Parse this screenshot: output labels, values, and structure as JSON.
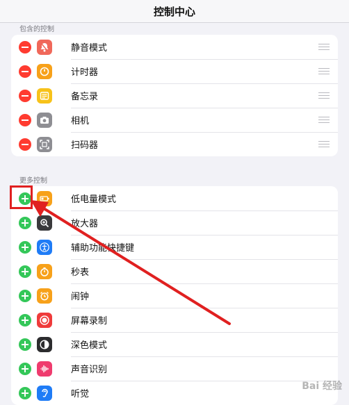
{
  "header": {
    "title": "控制中心"
  },
  "included": {
    "section_label": "包含的控制",
    "items": [
      {
        "label": "静音模式",
        "icon": "bell-slash-icon",
        "color": "#f0685a"
      },
      {
        "label": "计时器",
        "icon": "timer-icon",
        "color": "#f7a11a"
      },
      {
        "label": "备忘录",
        "icon": "notes-icon",
        "color": "#f7c21a"
      },
      {
        "label": "相机",
        "icon": "camera-icon",
        "color": "#8e8e93"
      },
      {
        "label": "扫码器",
        "icon": "qr-scanner-icon",
        "color": "#8e8e93"
      }
    ]
  },
  "more": {
    "section_label": "更多控制",
    "items": [
      {
        "label": "低电量模式",
        "icon": "battery-icon",
        "color": "#f7a11a"
      },
      {
        "label": "放大器",
        "icon": "magnifier-icon",
        "color": "#3a3a3c"
      },
      {
        "label": "辅助功能快捷键",
        "icon": "accessibility-icon",
        "color": "#1f7cf6"
      },
      {
        "label": "秒表",
        "icon": "stopwatch-icon",
        "color": "#f7a11a"
      },
      {
        "label": "闹钟",
        "icon": "alarm-icon",
        "color": "#f7a11a"
      },
      {
        "label": "屏幕录制",
        "icon": "screen-record-icon",
        "color": "#ef3b3b"
      },
      {
        "label": "深色模式",
        "icon": "dark-mode-icon",
        "color": "#2c2c2e"
      },
      {
        "label": "声音识别",
        "icon": "sound-recognition-icon",
        "color": "#ef3b6e"
      },
      {
        "label": "听觉",
        "icon": "hearing-icon",
        "color": "#1f7cf6"
      }
    ]
  },
  "watermark": "Bai 经验"
}
